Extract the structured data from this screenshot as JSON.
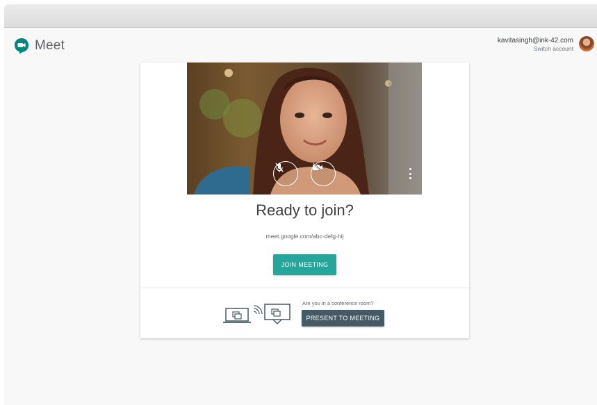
{
  "app": {
    "name": "Meet"
  },
  "account": {
    "email": "kavitasingh@ink-42.com",
    "switch_label": "Switch account"
  },
  "preview": {
    "mic_icon": "mic-off-icon",
    "camera_icon": "camera-off-icon",
    "more_icon": "more-vert-icon"
  },
  "main": {
    "title": "Ready to join?",
    "meeting_url": "meet.google.com/abc-defg-hij",
    "join_label": "JOIN MEETING"
  },
  "conference": {
    "question": "Are you in a conference room?",
    "present_label": "PRESENT TO MEETING"
  },
  "colors": {
    "join_button": "#26a69a",
    "present_button": "#455a64",
    "meet_green": "#00897b"
  }
}
